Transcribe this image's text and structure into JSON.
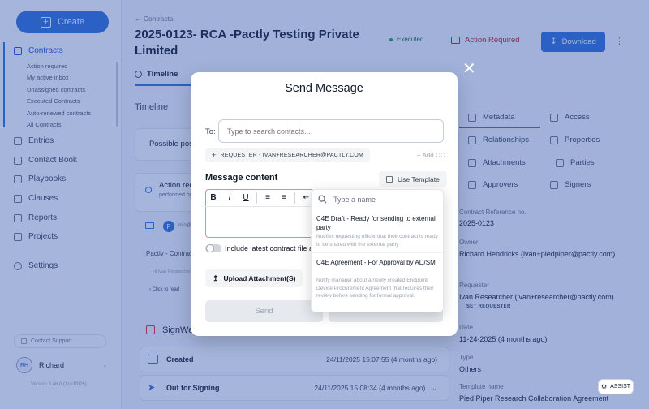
{
  "sidebar": {
    "create_label": "Create",
    "nav": [
      {
        "label": "Contracts",
        "active": true
      },
      {
        "label": "Entries"
      },
      {
        "label": "Contact Book"
      },
      {
        "label": "Playbooks"
      },
      {
        "label": "Clauses"
      },
      {
        "label": "Reports"
      },
      {
        "label": "Projects"
      },
      {
        "label": "Settings"
      }
    ],
    "contracts_sub": [
      "Action required",
      "My active inbox",
      "Unassigned contracts",
      "Executed Contracts",
      "Auto-renewed contracts",
      "All Contracts"
    ],
    "contact_support": "Contact Support",
    "user_initials": "RH",
    "user_name": "Richard",
    "version": "Version 3.46.0 (1ce1f826)"
  },
  "header": {
    "back": "Contracts",
    "title": "2025-0123- RCA -Pactly Testing Private Limited",
    "status": "Executed",
    "action": "Action Required",
    "download": "Download"
  },
  "timeline": {
    "tab": "Timeline",
    "heading": "Timeline",
    "possible": "Possible post",
    "action_req": "Action req",
    "action_sub": "performed by",
    "email_handle": "info@",
    "pactly_contract": "Pactly - Contract",
    "hi": "Hi Ivan Researcher",
    "click_read": "Click to read",
    "signwell": "SignWell",
    "rows": [
      {
        "label": "Created",
        "time": "24/11/2025 15:07:55 (4 months ago)"
      },
      {
        "label": "Out for Signing",
        "time": "24/11/2025 15:08:34 (4 months ago)"
      }
    ]
  },
  "right_panel": {
    "tabs": [
      [
        "Metadata",
        "Access"
      ],
      [
        "Relationships",
        "Properties"
      ],
      [
        "Attachments",
        "Parties"
      ],
      [
        "Approvers",
        "Signers"
      ]
    ],
    "fields": {
      "ref_label": "Contract Reference no.",
      "ref_value": "2025-0123",
      "owner_label": "Owner",
      "owner_value": "Richard Hendricks (ivan+piedpiper@pactly.com)",
      "requester_label": "Requester",
      "requester_value": "Ivan Researcher (ivan+researcher@pactly.com)",
      "set_requester": "SET REQUESTER",
      "date_label": "Date",
      "date_value": "11-24-2025 (4 months ago)",
      "type_label": "Type",
      "type_value": "Others",
      "template_label": "Template name",
      "template_value": "Pied Piper Research Collaboration Agreement"
    },
    "assist": "ASSIST"
  },
  "modal": {
    "title": "Send Message",
    "to_label": "To:",
    "to_placeholder": "Type to search contacts...",
    "requester_chip": "REQUESTER - IVAN+RESEARCHER@PACTLY.COM",
    "add_cc": "+ Add CC",
    "message_label": "Message content",
    "use_template": "Use Template",
    "toolbar": [
      "B",
      "I",
      "U"
    ],
    "include_file": "Include latest contract file as attachment",
    "upload": "Upload Attachment(S)",
    "send": "Send"
  },
  "template_dropdown": {
    "placeholder": "Type a name",
    "items": [
      {
        "title": "C4E Draft - Ready for sending to external party",
        "desc": "Notifies requesting officer that their contract is ready to be shared with the external party"
      },
      {
        "title": "C4E Agreement - For Approval by AD/SM",
        "desc": "Notify manager about a newly created Endpoint Device Procurement Agreement that requires their review before sending for formal approval."
      }
    ]
  },
  "colors": {
    "accent": "#2b6fd8",
    "overlay": "#2b4eab",
    "danger": "#b91c1c",
    "success": "#16a34a"
  }
}
